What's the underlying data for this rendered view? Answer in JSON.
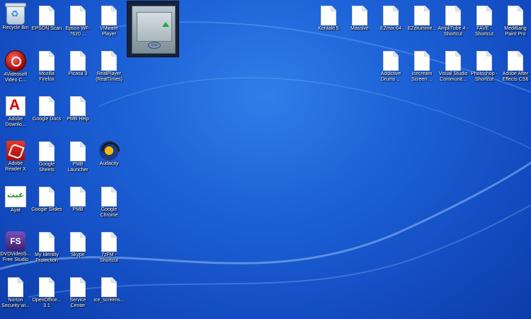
{
  "desktop": {
    "left_icons": [
      {
        "label": "Recycle Bin",
        "icon": "recycle-bin-icon"
      },
      {
        "label": "EPSON Scan",
        "icon": "document-icon"
      },
      {
        "label": "Epson WF-7620 ...",
        "icon": "document-icon"
      },
      {
        "label": "VMware Player",
        "icon": "document-icon"
      },
      {
        "label": "4Videosoft Video C...",
        "icon": "red-circle-icon"
      },
      {
        "label": "Mozilla Firefox",
        "icon": "document-icon"
      },
      {
        "label": "Picasa 3",
        "icon": "document-icon"
      },
      {
        "label": "RealPlayer (RealTimes)",
        "icon": "document-icon"
      },
      {
        "label": "Adobe Downlo...",
        "icon": "adobe-icon"
      },
      {
        "label": "Google Docs",
        "icon": "document-icon"
      },
      {
        "label": "PMB Help",
        "icon": "document-icon"
      },
      {
        "label": "Adobe Reader X",
        "icon": "adobe-reader-icon"
      },
      {
        "label": "Google Sheets",
        "icon": "document-icon"
      },
      {
        "label": "PMB Launcher",
        "icon": "document-icon"
      },
      {
        "label": "Audacity",
        "icon": "audacity-icon"
      },
      {
        "label": "Ayat",
        "icon": "ayat-icon"
      },
      {
        "label": "Google Slides",
        "icon": "document-icon"
      },
      {
        "label": "PMB",
        "icon": "document-icon"
      },
      {
        "label": "Google Chrome",
        "icon": "document-icon"
      },
      {
        "label": "DVDVideoS... Free Studio",
        "icon": "free-studio-icon"
      },
      {
        "label": "My Identity Protection",
        "icon": "document-icon"
      },
      {
        "label": "Skype",
        "icon": "document-icon"
      },
      {
        "label": "7zFM - Shortcut",
        "icon": "document-icon"
      },
      {
        "label": "Norton Security wi...",
        "icon": "document-icon"
      },
      {
        "label": "OpenOffice... 3.1",
        "icon": "document-icon"
      },
      {
        "label": "Service Center",
        "icon": "document-icon"
      },
      {
        "label": "ice_screens...",
        "icon": "document-icon"
      }
    ],
    "right_icons": [
      {
        "label": "Kontakt 5",
        "icon": "document-icon"
      },
      {
        "label": "Massive",
        "icon": "document-icon"
      },
      {
        "label": "EZmix-64",
        "icon": "document-icon"
      },
      {
        "label": "EZdrumme...",
        "icon": "document-icon"
      },
      {
        "label": "AmpliTube 4 - Shortcut",
        "icon": "document-icon"
      },
      {
        "label": "FAVE - Shortcut",
        "icon": "document-icon"
      },
      {
        "label": "MediBang Paint Pro",
        "icon": "document-icon"
      },
      {
        "label": "Addictive Drums ...",
        "icon": "document-icon"
      },
      {
        "label": "Icecream Screen ...",
        "icon": "document-icon"
      },
      {
        "label": "Visual Studio Communit...",
        "icon": "document-icon"
      },
      {
        "label": "Photoshop - Shortcut",
        "icon": "document-icon"
      },
      {
        "label": "Adobe After Effects CS6",
        "icon": "document-icon"
      }
    ],
    "gadget": {
      "icon": "cpu-meter-gadget-icon",
      "brand": "intel"
    }
  }
}
